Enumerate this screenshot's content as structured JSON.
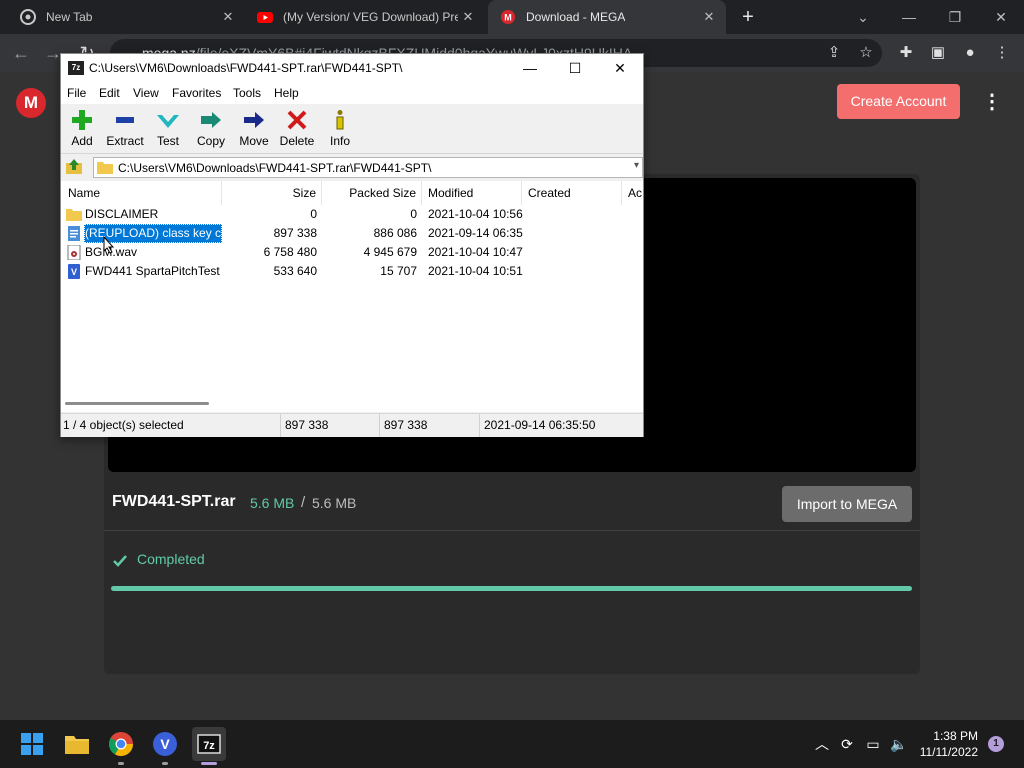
{
  "browser": {
    "tabs": [
      {
        "title": "New Tab",
        "active": false
      },
      {
        "title": "(My Version/ VEG Download) Pre",
        "active": false
      },
      {
        "title": "Download - MEGA",
        "active": true
      }
    ],
    "address_host": "mega.nz",
    "address_path": "/file/eXZVmY6B#i4FiwtdNkgzBFXZUMidd0hqaYwuWvLJ0xztH9UkIHA"
  },
  "mega": {
    "logo_letter": "M",
    "create_account_label": "Create Account",
    "file_name": "FWD441-SPT.rar",
    "downloaded_size": "5.6 MB",
    "size_separator": "/",
    "total_size": "5.6 MB",
    "import_label": "Import to MEGA",
    "status_label": "Completed",
    "progress_fraction": 1.0,
    "colors": {
      "accent_green": "#61c9a8",
      "brand_red": "#d9272e",
      "button_red": "#f46e6e"
    }
  },
  "sevenzip": {
    "app_icon_text": "7z",
    "title": "C:\\Users\\VM6\\Downloads\\FWD441-SPT.rar\\FWD441-SPT\\",
    "menu": [
      "File",
      "Edit",
      "View",
      "Favorites",
      "Tools",
      "Help"
    ],
    "tools": [
      {
        "label": "Add",
        "icon": "plus-icon"
      },
      {
        "label": "Extract",
        "icon": "minus-icon"
      },
      {
        "label": "Test",
        "icon": "check-icon"
      },
      {
        "label": "Copy",
        "icon": "double-arrow-icon"
      },
      {
        "label": "Move",
        "icon": "arrow-icon"
      },
      {
        "label": "Delete",
        "icon": "cross-icon"
      },
      {
        "label": "Info",
        "icon": "info-icon"
      }
    ],
    "path": "C:\\Users\\VM6\\Downloads\\FWD441-SPT.rar\\FWD441-SPT\\",
    "columns": [
      "Name",
      "Size",
      "Packed Size",
      "Modified",
      "Created",
      "Ac"
    ],
    "rows": [
      {
        "name": "DISCLAIMER",
        "size": "0",
        "packed": "0",
        "modified": "2021-10-04 10:56",
        "icon": "folder-icon",
        "selected": false
      },
      {
        "name": "(REUPLOAD) class key c...",
        "size": "897 338",
        "packed": "886 086",
        "modified": "2021-09-14 06:35",
        "icon": "document-icon",
        "selected": true
      },
      {
        "name": "BGM.wav",
        "size": "6 758 480",
        "packed": "4 945 679",
        "modified": "2021-10-04 10:47",
        "icon": "audio-file-icon",
        "selected": false
      },
      {
        "name": "FWD441 SpartaPitchTest...",
        "size": "533 640",
        "packed": "15 707",
        "modified": "2021-10-04 10:51",
        "icon": "veg-file-icon",
        "selected": false
      }
    ],
    "status": {
      "selection": "1 / 4 object(s) selected",
      "size": "897 338",
      "packed": "897 338",
      "modified": "2021-09-14 06:35:50"
    }
  },
  "taskbar": {
    "apps": [
      "windows-start-icon",
      "file-explorer-icon",
      "chrome-icon",
      "vegas-icon",
      "7zip-icon"
    ],
    "time": "1:38 PM",
    "date": "11/11/2022",
    "notification_count": "1"
  }
}
